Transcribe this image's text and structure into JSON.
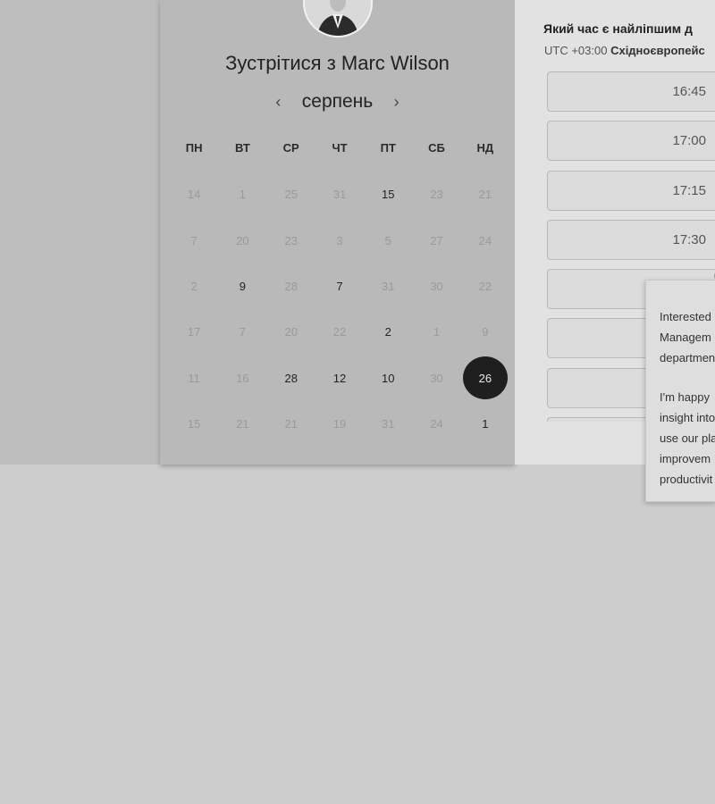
{
  "booking": {
    "host_title": "Зустрітися з Marc Wilson",
    "month": "серпень",
    "prev_arrow": "‹",
    "next_arrow": "›",
    "weekdays": [
      "ПН",
      "ВТ",
      "СР",
      "ЧТ",
      "ПТ",
      "СБ",
      "НД"
    ],
    "weeks": [
      [
        {
          "d": "14",
          "a": false
        },
        {
          "d": "1",
          "a": false
        },
        {
          "d": "25",
          "a": false
        },
        {
          "d": "31",
          "a": false
        },
        {
          "d": "15",
          "a": true
        },
        {
          "d": "23",
          "a": false
        },
        {
          "d": "21",
          "a": false
        }
      ],
      [
        {
          "d": "7",
          "a": false
        },
        {
          "d": "20",
          "a": false
        },
        {
          "d": "23",
          "a": false
        },
        {
          "d": "3",
          "a": false
        },
        {
          "d": "5",
          "a": false
        },
        {
          "d": "27",
          "a": false
        },
        {
          "d": "24",
          "a": false
        }
      ],
      [
        {
          "d": "2",
          "a": false
        },
        {
          "d": "9",
          "a": true
        },
        {
          "d": "28",
          "a": false
        },
        {
          "d": "7",
          "a": true
        },
        {
          "d": "31",
          "a": false
        },
        {
          "d": "30",
          "a": false
        },
        {
          "d": "22",
          "a": false
        }
      ],
      [
        {
          "d": "17",
          "a": false
        },
        {
          "d": "7",
          "a": false
        },
        {
          "d": "20",
          "a": false
        },
        {
          "d": "22",
          "a": false
        },
        {
          "d": "2",
          "a": true
        },
        {
          "d": "1",
          "a": false
        },
        {
          "d": "9",
          "a": false
        }
      ],
      [
        {
          "d": "11",
          "a": false
        },
        {
          "d": "16",
          "a": false
        },
        {
          "d": "28",
          "a": true
        },
        {
          "d": "12",
          "a": true
        },
        {
          "d": "10",
          "a": true
        },
        {
          "d": "30",
          "a": false
        },
        {
          "d": "26",
          "a": true,
          "s": true
        }
      ],
      [
        {
          "d": "15",
          "a": false
        },
        {
          "d": "21",
          "a": false
        },
        {
          "d": "21",
          "a": false
        },
        {
          "d": "19",
          "a": false
        },
        {
          "d": "31",
          "a": false
        },
        {
          "d": "24",
          "a": false
        },
        {
          "d": "1",
          "a": true
        }
      ]
    ]
  },
  "times": {
    "question": "Який час є найліпшим д",
    "tz_prefix": "UTC +03:00",
    "tz_name": "Східноєвропейс",
    "slots": [
      "16:45",
      "17:00",
      "17:15",
      "17:30",
      "",
      "",
      "",
      ""
    ]
  },
  "popover": {
    "para1": [
      "Interested",
      "Managem",
      "departmen"
    ],
    "para2": [
      "I'm happy",
      "insight into",
      "use our pla",
      "improvem",
      "productivit"
    ]
  },
  "colors": {
    "selected_day": "#1f1f1f",
    "background": "#cdcdcd"
  }
}
